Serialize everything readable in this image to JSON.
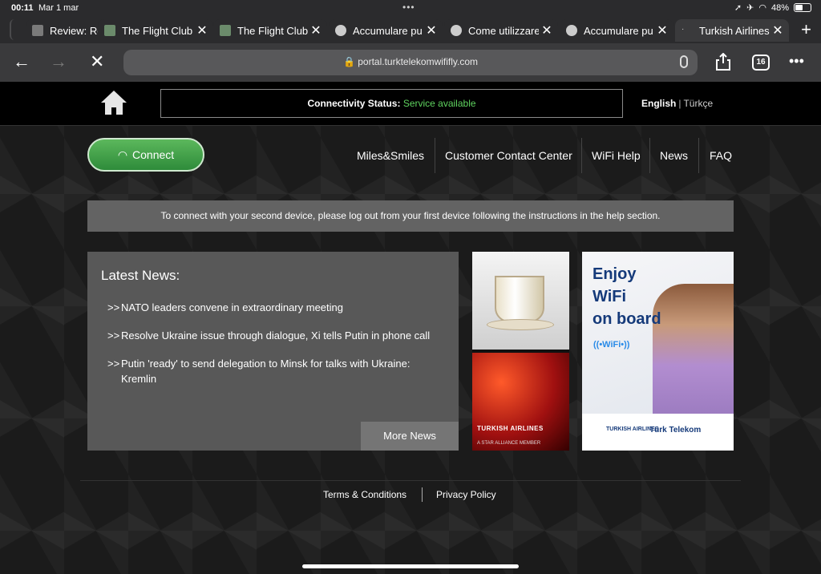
{
  "status_bar": {
    "time": "00:11",
    "date": "Mar 1 mar",
    "battery": "48%",
    "battery_level": 0.48
  },
  "tabs": [
    {
      "title": "Review: Ro",
      "favicon": "ml-favicon",
      "color": "#7a7a7a"
    },
    {
      "title": "The Flight Club",
      "favicon": "flightclub-favicon",
      "color": "#6b8b6b"
    },
    {
      "title": "The Flight Club",
      "favicon": "flightclub-favicon",
      "color": "#6b8b6b"
    },
    {
      "title": "Accumulare pu",
      "favicon": "globe-icon",
      "color": "#cccccc"
    },
    {
      "title": "Come utilizzare",
      "favicon": "globe-icon",
      "color": "#cccccc"
    },
    {
      "title": "Accumulare pu",
      "favicon": "globe-icon",
      "color": "#cccccc"
    },
    {
      "title": "Turkish Airlines",
      "favicon": "loading-icon",
      "color": "#cccccc",
      "active": true
    }
  ],
  "toolbar": {
    "url": "portal.turktelekomwififly.com",
    "tab_count": "16"
  },
  "header": {
    "connectivity_label": "Connectivity Status:",
    "connectivity_value": "Service available",
    "lang_en": "English",
    "lang_tr": "Türkçe"
  },
  "nav": {
    "connect": "Connect",
    "items": [
      "Miles&Smiles",
      "Customer Contact Center",
      "WiFi Help",
      "News",
      "FAQ"
    ]
  },
  "notice": "To connect with your second device, please log out from your first device following the instructions in the help section.",
  "news": {
    "title": "Latest News:",
    "items": [
      "NATO leaders convene in extraordinary meeting",
      "Resolve Ukraine issue through dialogue, Xi tells Putin in phone call",
      "Putin 'ready' to send delegation to Minsk for talks with Ukraine: Kremlin"
    ],
    "prefix": ">>",
    "more": "More News"
  },
  "ads": {
    "ad1_brand": "TURKISH AIRLINES",
    "ad1_tagline": "A STAR ALLIANCE MEMBER",
    "ad2_headline_1": "Enjoy",
    "ad2_headline_2": "WiFi",
    "ad2_headline_3": "on board",
    "ad2_wifi": "((•WiFi•))",
    "ad2_logo_1": "TURKISH AIRLINES",
    "ad2_logo_2": "Türk Telekom"
  },
  "footer": {
    "terms": "Terms & Conditions",
    "privacy": "Privacy Policy"
  },
  "colors": {
    "status_ok": "#5fd35f",
    "connect_green": "#3a9a48"
  }
}
